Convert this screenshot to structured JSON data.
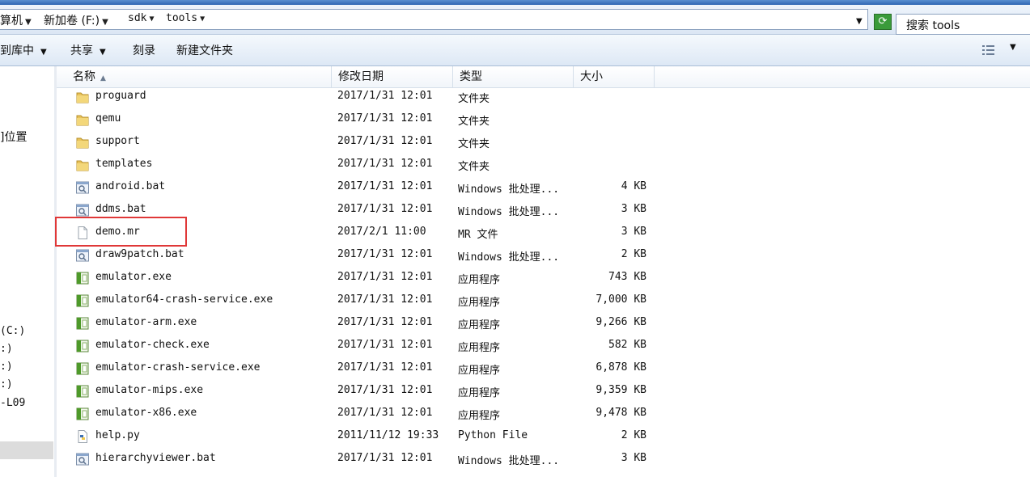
{
  "address": {
    "crumbs": [
      "算机",
      "新加卷 (F:)",
      "sdk",
      "tools"
    ],
    "search_placeholder": "搜索 tools"
  },
  "toolbar": {
    "include_label": "到库中",
    "share_label": "共享",
    "burn_label": "刻录",
    "new_folder_label": "新建文件夹"
  },
  "nav": {
    "items": [
      "]位置",
      "(C:)",
      ":)",
      ":)",
      ":)",
      "-L09"
    ]
  },
  "columns": {
    "name": "名称",
    "date": "修改日期",
    "type": "类型",
    "size": "大小"
  },
  "files": [
    {
      "name": "proguard",
      "date": "2017/1/31 12:01",
      "type": "文件夹",
      "size": "",
      "icon": "folder-icon"
    },
    {
      "name": "qemu",
      "date": "2017/1/31 12:01",
      "type": "文件夹",
      "size": "",
      "icon": "folder-icon"
    },
    {
      "name": "support",
      "date": "2017/1/31 12:01",
      "type": "文件夹",
      "size": "",
      "icon": "folder-icon"
    },
    {
      "name": "templates",
      "date": "2017/1/31 12:01",
      "type": "文件夹",
      "size": "",
      "icon": "folder-icon"
    },
    {
      "name": "android.bat",
      "date": "2017/1/31 12:01",
      "type": "Windows 批处理...",
      "size": "4 KB",
      "icon": "batch-file-icon"
    },
    {
      "name": "ddms.bat",
      "date": "2017/1/31 12:01",
      "type": "Windows 批处理...",
      "size": "3 KB",
      "icon": "batch-file-icon"
    },
    {
      "name": "demo.mr",
      "date": "2017/2/1 11:00",
      "type": "MR 文件",
      "size": "3 KB",
      "icon": "blank-file-icon"
    },
    {
      "name": "draw9patch.bat",
      "date": "2017/1/31 12:01",
      "type": "Windows 批处理...",
      "size": "2 KB",
      "icon": "batch-file-icon"
    },
    {
      "name": "emulator.exe",
      "date": "2017/1/31 12:01",
      "type": "应用程序",
      "size": "743 KB",
      "icon": "exe-icon"
    },
    {
      "name": "emulator64-crash-service.exe",
      "date": "2017/1/31 12:01",
      "type": "应用程序",
      "size": "7,000 KB",
      "icon": "exe-icon"
    },
    {
      "name": "emulator-arm.exe",
      "date": "2017/1/31 12:01",
      "type": "应用程序",
      "size": "9,266 KB",
      "icon": "exe-icon"
    },
    {
      "name": "emulator-check.exe",
      "date": "2017/1/31 12:01",
      "type": "应用程序",
      "size": "582 KB",
      "icon": "exe-icon"
    },
    {
      "name": "emulator-crash-service.exe",
      "date": "2017/1/31 12:01",
      "type": "应用程序",
      "size": "6,878 KB",
      "icon": "exe-icon"
    },
    {
      "name": "emulator-mips.exe",
      "date": "2017/1/31 12:01",
      "type": "应用程序",
      "size": "9,359 KB",
      "icon": "exe-icon"
    },
    {
      "name": "emulator-x86.exe",
      "date": "2017/1/31 12:01",
      "type": "应用程序",
      "size": "9,478 KB",
      "icon": "exe-icon"
    },
    {
      "name": "help.py",
      "date": "2011/11/12 19:33",
      "type": "Python File",
      "size": "2 KB",
      "icon": "python-file-icon"
    },
    {
      "name": "hierarchyviewer.bat",
      "date": "2017/1/31 12:01",
      "type": "Windows 批处理...",
      "size": "3 KB",
      "icon": "batch-file-icon"
    }
  ],
  "colors": {
    "highlight_box": "#e03838",
    "folder": "#e8c25a"
  }
}
